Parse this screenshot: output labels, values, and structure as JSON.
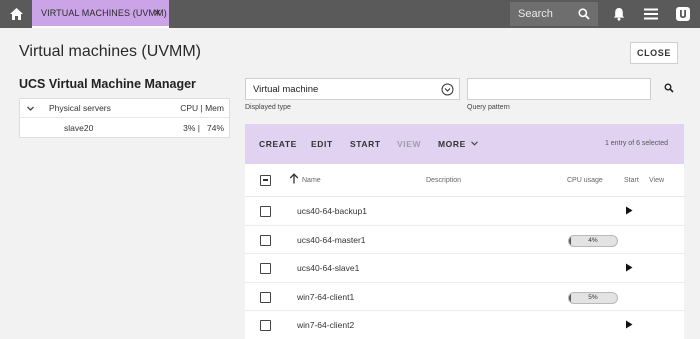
{
  "topbar": {
    "tab_label": "VIRTUAL MACHINES (UVMM)",
    "tab_close": "×",
    "search_label": "Search"
  },
  "page": {
    "title": "Virtual machines (UVMM)",
    "close_label": "CLOSE"
  },
  "tree": {
    "title": "UCS Virtual Machine Manager",
    "root_label": "Physical servers",
    "cpu_mem_header": "CPU | Mem",
    "children": [
      {
        "label": "slave20",
        "cpu": "3% |",
        "mem": "74%"
      }
    ]
  },
  "filter": {
    "type_value": "Virtual machine",
    "type_label": "Displayed type",
    "query_value": "",
    "query_label": "Query pattern"
  },
  "grid": {
    "toolbar": {
      "create": "CREATE",
      "edit": "EDIT",
      "start": "START",
      "view": "VIEW",
      "more": "MORE",
      "selection_info": "1 entry of 6 selected"
    },
    "headers": {
      "name": "Name",
      "description": "Description",
      "cpu": "CPU usage",
      "start": "Start",
      "view": "View"
    },
    "rows": [
      {
        "name": "ucs40-64-backup1",
        "cpu": null,
        "cpu_fraction": null,
        "can_start": true
      },
      {
        "name": "ucs40-64-master1",
        "cpu": "4%",
        "cpu_fraction": 0.04,
        "can_start": false
      },
      {
        "name": "ucs40-64-slave1",
        "cpu": null,
        "cpu_fraction": null,
        "can_start": true
      },
      {
        "name": "win7-64-client1",
        "cpu": "5%",
        "cpu_fraction": 0.05,
        "can_start": false
      },
      {
        "name": "win7-64-client2",
        "cpu": null,
        "cpu_fraction": null,
        "can_start": true
      }
    ]
  },
  "colors": {
    "topbar": "#5a5a5a",
    "tab_accent": "#cba4e8",
    "toolbar_bg": "#e2d2f2",
    "page_bg": "#f2f2f2"
  }
}
